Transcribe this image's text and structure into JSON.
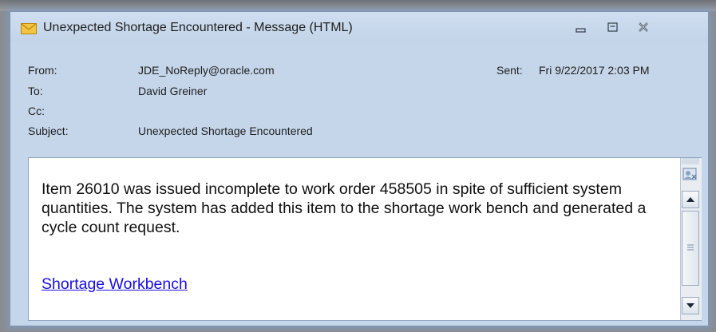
{
  "window": {
    "title": "Unexpected Shortage Encountered - Message (HTML)",
    "icon": "envelope-icon",
    "controls": [
      "minimize-icon",
      "maximize-icon",
      "close-icon"
    ]
  },
  "header": {
    "from_label": "From:",
    "from_value": "JDE_NoReply@oracle.com",
    "to_label": "To:",
    "to_value": "David Greiner",
    "cc_label": "Cc:",
    "cc_value": "",
    "subject_label": "Subject:",
    "subject_value": "Unexpected Shortage Encountered",
    "sent_label": "Sent:",
    "sent_value": "Fri 9/22/2017 2:03 PM"
  },
  "message": {
    "body_text": "Item 26010 was issued incomplete to work order 458505 in spite of sufficient system quantities. The system has added this item to the shortage work bench and generated a cycle count request.",
    "link_text": "Shortage Workbench"
  },
  "colors": {
    "window_bg": "#c5d6ea",
    "link": "#1a0ee0",
    "pane_bg": "#ffffff"
  }
}
